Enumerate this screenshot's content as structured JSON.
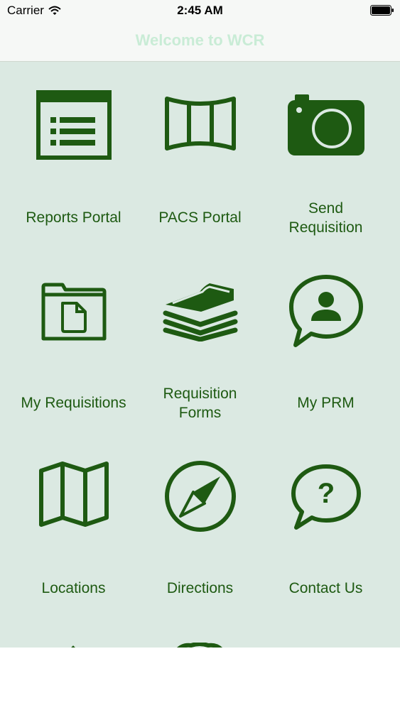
{
  "status_bar": {
    "carrier": "Carrier",
    "time": "2:45 AM"
  },
  "nav": {
    "title": "Welcome to WCR"
  },
  "colors": {
    "icon": "#1e5a12",
    "background": "#dbe9e2",
    "title": "#c9ecd6"
  },
  "tiles": [
    {
      "label": "Reports Portal",
      "icon": "report-list-icon"
    },
    {
      "label": "PACS Portal",
      "icon": "panorama-icon"
    },
    {
      "label": "Send Requisition",
      "icon": "camera-icon"
    },
    {
      "label": "My Requisitions",
      "icon": "folder-file-icon"
    },
    {
      "label": "Requisition Forms",
      "icon": "paper-stack-icon"
    },
    {
      "label": "My PRM",
      "icon": "person-speech-icon"
    },
    {
      "label": "Locations",
      "icon": "map-icon"
    },
    {
      "label": "Directions",
      "icon": "compass-icon"
    },
    {
      "label": "Contact Us",
      "icon": "question-speech-icon"
    }
  ]
}
